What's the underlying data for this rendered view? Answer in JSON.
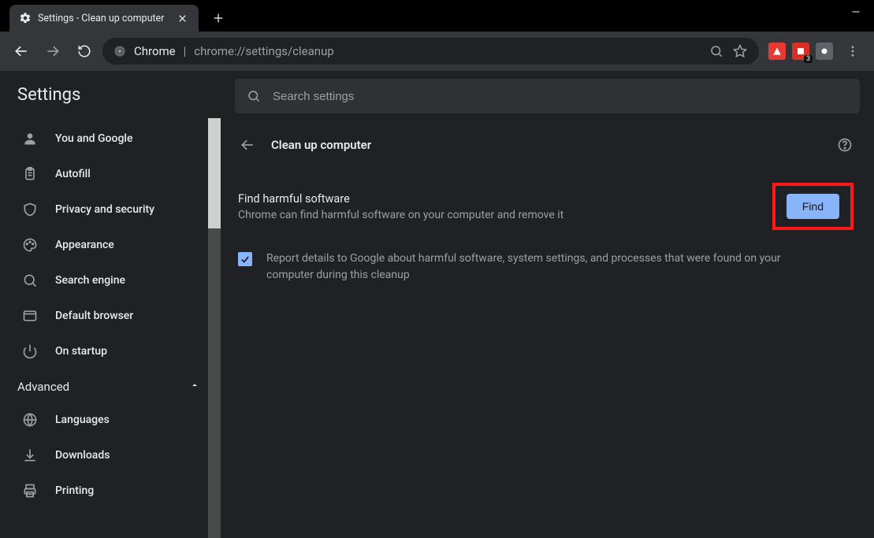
{
  "window": {
    "tab_title": "Settings - Clean up computer",
    "minimize": "—"
  },
  "toolbar": {
    "url_scheme_label": "Chrome",
    "url_path": "chrome://settings/cleanup"
  },
  "extensions": {
    "badge_count": "3"
  },
  "sidebar": {
    "title": "Settings",
    "items": [
      {
        "label": "You and Google"
      },
      {
        "label": "Autofill"
      },
      {
        "label": "Privacy and security"
      },
      {
        "label": "Appearance"
      },
      {
        "label": "Search engine"
      },
      {
        "label": "Default browser"
      },
      {
        "label": "On startup"
      }
    ],
    "advanced": "Advanced",
    "advanced_items": [
      {
        "label": "Languages"
      },
      {
        "label": "Downloads"
      },
      {
        "label": "Printing"
      }
    ]
  },
  "search": {
    "placeholder": "Search settings"
  },
  "page": {
    "title": "Clean up computer",
    "find_title": "Find harmful software",
    "find_sub": "Chrome can find harmful software on your computer and remove it",
    "find_button": "Find",
    "report_label": "Report details to Google about harmful software, system settings, and processes that were found on your computer during this cleanup"
  }
}
